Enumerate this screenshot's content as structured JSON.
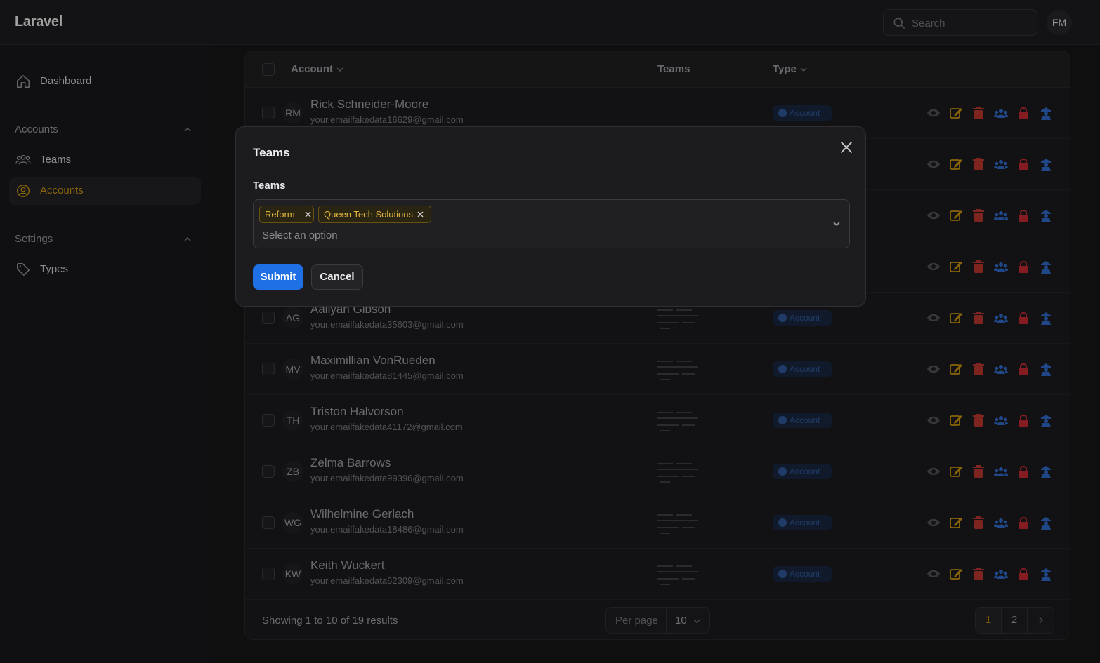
{
  "app": {
    "brand": "Laravel",
    "user_initials": "FM"
  },
  "search": {
    "placeholder": "Search"
  },
  "sidebar": {
    "dashboard": "Dashboard",
    "group_accounts": "Accounts",
    "teams": "Teams",
    "accounts": "Accounts",
    "group_settings": "Settings",
    "types": "Types"
  },
  "table": {
    "headers": {
      "account": "Account",
      "teams": "Teams",
      "type": "Type"
    },
    "type_badge": "Account",
    "rows": [
      {
        "initials": "RM",
        "name": "Rick Schneider-Moore",
        "email": "your.emailfakedata16629@gmail.com"
      },
      {
        "initials": "",
        "name": "",
        "email": ""
      },
      {
        "initials": "",
        "name": "",
        "email": ""
      },
      {
        "initials": "",
        "name": "",
        "email": ""
      },
      {
        "initials": "AG",
        "name": "Aaliyah Gibson",
        "email": "your.emailfakedata35603@gmail.com"
      },
      {
        "initials": "MV",
        "name": "Maximillian VonRueden",
        "email": "your.emailfakedata81445@gmail.com"
      },
      {
        "initials": "TH",
        "name": "Triston Halvorson",
        "email": "your.emailfakedata41172@gmail.com"
      },
      {
        "initials": "ZB",
        "name": "Zelma Barrows",
        "email": "your.emailfakedata99396@gmail.com"
      },
      {
        "initials": "WG",
        "name": "Wilhelmine Gerlach",
        "email": "your.emailfakedata18486@gmail.com"
      },
      {
        "initials": "KW",
        "name": "Keith Wuckert",
        "email": "your.emailfakedata62309@gmail.com"
      }
    ],
    "summary": "Showing 1 to 10 of 19 results",
    "per_page_label": "Per page",
    "per_page_value": "10",
    "pages": [
      "1",
      "2"
    ],
    "current_page": "1"
  },
  "modal": {
    "title": "Teams",
    "field_label": "Teams",
    "selected": [
      "Reform",
      "Queen Tech Solutions"
    ],
    "placeholder": "Select an option",
    "submit": "Submit",
    "cancel": "Cancel"
  },
  "colors": {
    "accent": "#b8860b",
    "primary": "#1f6fe5",
    "chip_text": "#e0b640",
    "danger": "#c0392b",
    "info": "#2b5fb5"
  }
}
